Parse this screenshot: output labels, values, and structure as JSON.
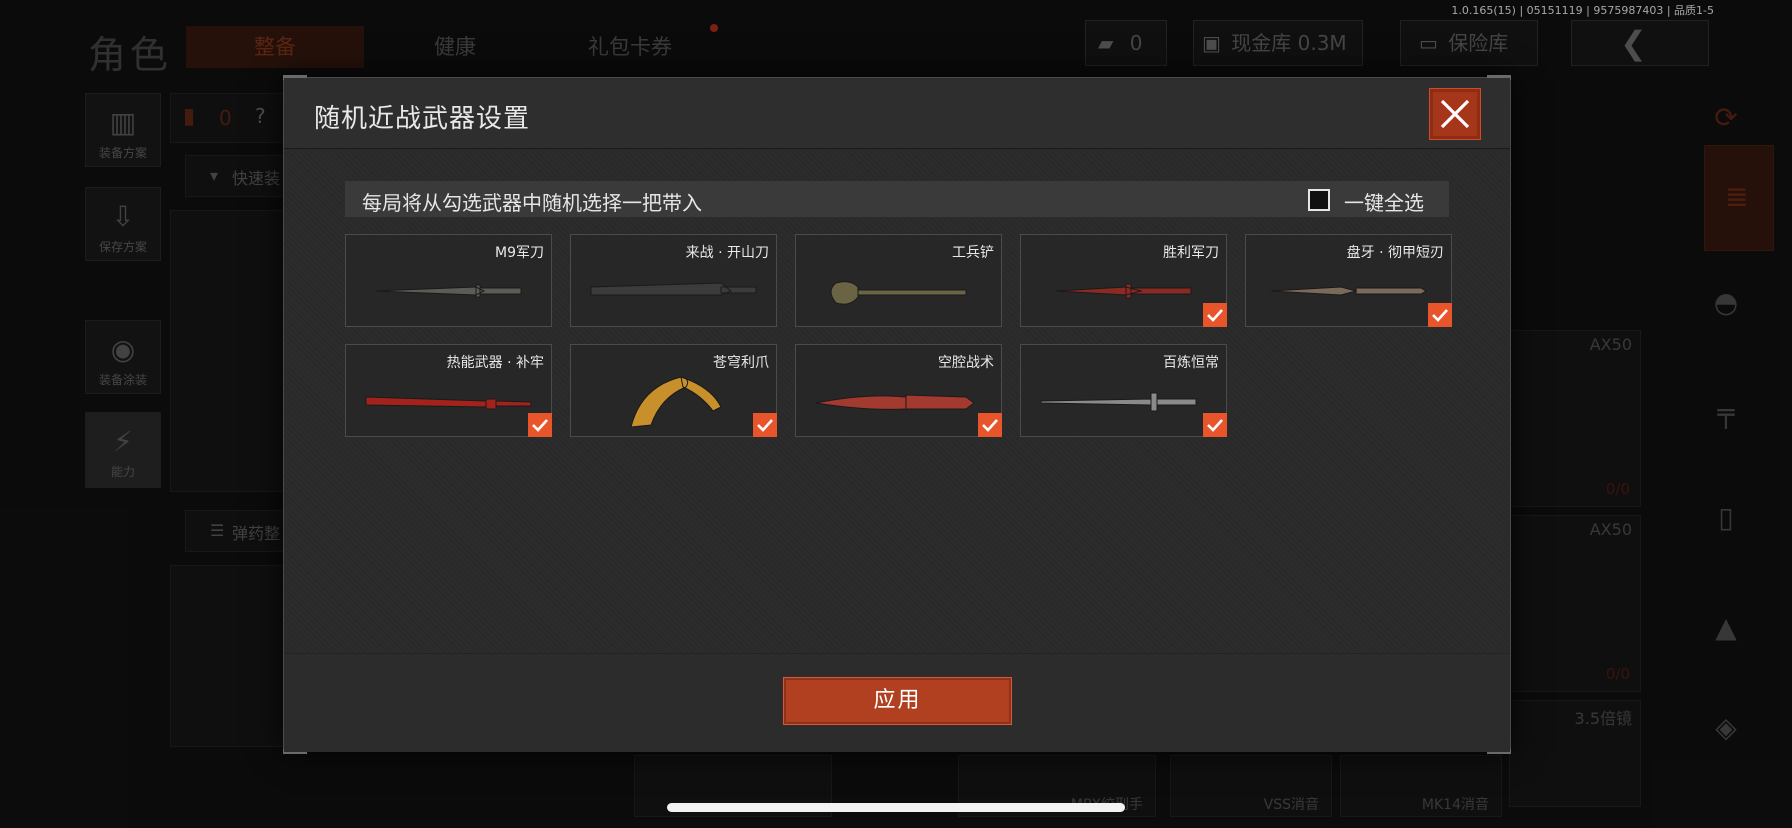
{
  "status": {
    "build_info": "1.0.165(15) | 05151119 | 9575987403 | 品质1-5"
  },
  "background": {
    "page_title": "角色",
    "tabs": [
      {
        "label": "整备"
      },
      {
        "label": "健康"
      },
      {
        "label": "礼包卡券"
      }
    ],
    "currency_value": "0",
    "cash_vault_label": "现金库 0.3M",
    "safe_box_label": "保险库",
    "left_buttons": [
      {
        "label": "装备方案"
      },
      {
        "label": "保存方案"
      },
      {
        "label": "装备涂装"
      },
      {
        "label": "能力"
      }
    ],
    "quick_equip_label": "快速装",
    "ammo_label": "弹药整",
    "counter_value": "0",
    "help_mark": "?",
    "list_items": [
      {
        "name": "AX50",
        "count": "0/0"
      },
      {
        "name": "AX50",
        "count": "0/0"
      },
      {
        "name": "3.5倍镜"
      }
    ],
    "bottom_items": [
      "MPX绞刑手",
      "VSS消音",
      "MK14消音"
    ]
  },
  "modal": {
    "title": "随机近战武器设置",
    "info_text": "每局将从勾选武器中随机选择一把带入",
    "select_all_label": "一键全选",
    "apply_label": "应用",
    "weapons": [
      {
        "name": "M9军刀",
        "checked": false,
        "color": "#5a5d55"
      },
      {
        "name": "来战 · 开山刀",
        "checked": false,
        "color": "#3b3b3b"
      },
      {
        "name": "工兵铲",
        "checked": false,
        "color": "#6a6444"
      },
      {
        "name": "胜利军刀",
        "checked": true,
        "color": "#8a2a22"
      },
      {
        "name": "盘牙 · 彻甲短刃",
        "checked": true,
        "color": "#7a6a5a"
      },
      {
        "name": "热能武器 · 补牢",
        "checked": true,
        "color": "#a3221c"
      },
      {
        "name": "苍穹利爪",
        "checked": true,
        "color": "#c8902a"
      },
      {
        "name": "空腔战术",
        "checked": true,
        "color": "#a23a30"
      },
      {
        "name": "百炼恒常",
        "checked": true,
        "color": "#8a8a8a"
      }
    ]
  },
  "colors": {
    "accent": "#e8552a",
    "close_bg": "#a5361a",
    "apply_bg": "#b04020"
  }
}
